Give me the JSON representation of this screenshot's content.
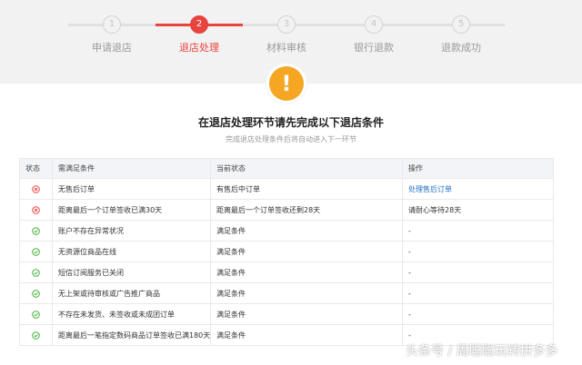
{
  "steps": [
    {
      "num": "1",
      "label": "申请退店"
    },
    {
      "num": "2",
      "label": "退店处理"
    },
    {
      "num": "3",
      "label": "材料审核"
    },
    {
      "num": "4",
      "label": "银行退款"
    },
    {
      "num": "5",
      "label": "退款成功"
    }
  ],
  "active_step": 2,
  "notice": {
    "icon": "warning-icon",
    "symbol": "!",
    "title": "在退店处理环节请先完成以下退店条件",
    "subtitle": "完成退店处理条件后将自动进入下一环节"
  },
  "table": {
    "headers": {
      "status": "状态",
      "condition": "需满足条件",
      "current": "当前状态",
      "action": "操作"
    },
    "rows": [
      {
        "status": "fail",
        "condition": "无售后订单",
        "current": "有售后中订单",
        "action": "处理售后订单",
        "action_link": true
      },
      {
        "status": "fail",
        "condition": "距离最后一个订单签收已满30天",
        "current": "距离最后一个订单签收还剩28天",
        "action": "请耐心等待28天",
        "action_link": false
      },
      {
        "status": "ok",
        "condition": "账户不存在异常状况",
        "current": "满足条件",
        "action": "-",
        "action_link": false
      },
      {
        "status": "ok",
        "condition": "无资源位商品在线",
        "current": "满足条件",
        "action": "-",
        "action_link": false
      },
      {
        "status": "ok",
        "condition": "短信订阅服务已关闭",
        "current": "满足条件",
        "action": "-",
        "action_link": false
      },
      {
        "status": "ok",
        "condition": "无上架或待审核或广告推广商品",
        "current": "满足条件",
        "action": "-",
        "action_link": false
      },
      {
        "status": "ok",
        "condition": "不存在未发货、未签收或未成团订单",
        "current": "满足条件",
        "action": "-",
        "action_link": false
      },
      {
        "status": "ok",
        "condition": "距离最后一笔指定数码商品订单签收已满180天",
        "current": "满足条件",
        "action": "-",
        "action_link": false
      }
    ]
  },
  "watermark": "头条号 / 周聪聪玩转拼多多",
  "colors": {
    "accent": "#e8443f",
    "fail": "#e8443f",
    "ok": "#3cb034",
    "link": "#1f6fc2",
    "warning": "#f5a623"
  }
}
